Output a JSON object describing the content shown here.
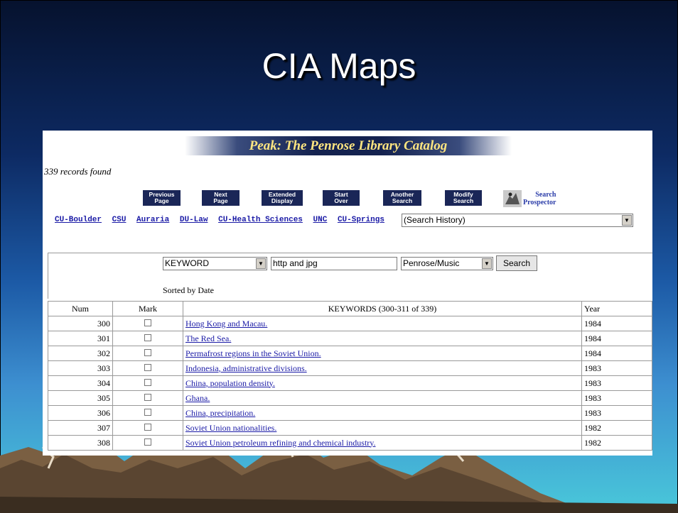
{
  "slide": {
    "title": "CIA Maps"
  },
  "catalog": {
    "banner": "Peak: The Penrose Library Catalog",
    "records_found": "339 records found",
    "buttons": [
      {
        "line1": "Previous",
        "line2": "Page"
      },
      {
        "line1": "Next",
        "line2": "Page"
      },
      {
        "line1": "Extended",
        "line2": "Display"
      },
      {
        "line1": "Start",
        "line2": "Over"
      },
      {
        "line1": "Another",
        "line2": "Search"
      },
      {
        "line1": "Modify",
        "line2": "Search"
      }
    ],
    "search_logo": {
      "line1": "Search",
      "line2": "Prospector"
    },
    "libraries": [
      "CU-Boulder",
      "CSU",
      "Auraria",
      "DU-Law",
      "CU-Health Sciences",
      "UNC",
      "CU-Springs"
    ],
    "history_select": "(Search History)",
    "search": {
      "type_select": "KEYWORD",
      "query": "http and jpg",
      "scope_select": "Penrose/Music",
      "button": "Search"
    },
    "sorted_by": "Sorted by Date",
    "table": {
      "headers": [
        "Num",
        "Mark",
        "KEYWORDS (300-311 of 339)",
        "Year"
      ],
      "rows": [
        {
          "num": "300",
          "title": "Hong Kong and Macau.",
          "year": "1984"
        },
        {
          "num": "301",
          "title": "The Red Sea.",
          "year": "1984"
        },
        {
          "num": "302",
          "title": "Permafrost regions in the Soviet Union.",
          "year": "1984"
        },
        {
          "num": "303",
          "title": "Indonesia, administrative divisions.",
          "year": "1983"
        },
        {
          "num": "304",
          "title": "China, population density.",
          "year": "1983"
        },
        {
          "num": "305",
          "title": "Ghana.",
          "year": "1983"
        },
        {
          "num": "306",
          "title": "China, precipitation.",
          "year": "1983"
        },
        {
          "num": "307",
          "title": "Soviet Union nationalities.",
          "year": "1982"
        },
        {
          "num": "308",
          "title": "Soviet Union petroleum refining and chemical industry.",
          "year": "1982"
        }
      ]
    }
  }
}
